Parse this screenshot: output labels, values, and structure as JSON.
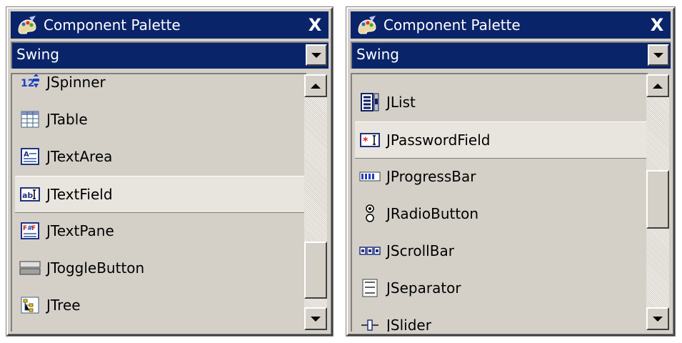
{
  "left_palette": {
    "title": "Component Palette",
    "close_label": "X",
    "category": "Swing",
    "items": [
      {
        "label": "JSpinner",
        "icon": "spinner-icon"
      },
      {
        "label": "JTable",
        "icon": "table-icon"
      },
      {
        "label": "JTextArea",
        "icon": "textarea-icon"
      },
      {
        "label": "JTextField",
        "icon": "textfield-icon"
      },
      {
        "label": "JTextPane",
        "icon": "textpane-icon"
      },
      {
        "label": "JToggleButton",
        "icon": "togglebutton-icon"
      },
      {
        "label": "JTree",
        "icon": "tree-icon"
      }
    ],
    "selected_item": "JTextField",
    "scroll_position": 0.9
  },
  "right_palette": {
    "title": "Component Palette",
    "close_label": "X",
    "category": "Swing",
    "items": [
      {
        "label": "JList",
        "icon": "list-icon"
      },
      {
        "label": "JPasswordField",
        "icon": "passwordfield-icon"
      },
      {
        "label": "JProgressBar",
        "icon": "progressbar-icon"
      },
      {
        "label": "JRadioButton",
        "icon": "radiobutton-icon"
      },
      {
        "label": "JScrollBar",
        "icon": "scrollbar-icon"
      },
      {
        "label": "JSeparator",
        "icon": "separator-icon"
      },
      {
        "label": "JSlider",
        "icon": "slider-icon"
      }
    ],
    "selected_item": "JPasswordField",
    "scroll_position": 0.55
  },
  "colors": {
    "titlebar": "#0a246a",
    "panel": "#d4d0c8",
    "selected_row": "#e8e5de"
  }
}
